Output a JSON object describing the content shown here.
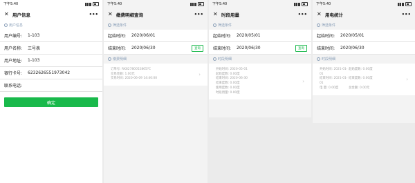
{
  "status": {
    "time": "下午5:40"
  },
  "screen1": {
    "title": "用户信息",
    "section": "用户信息",
    "rows": [
      {
        "label": "用户编号:",
        "value": "1-103"
      },
      {
        "label": "用户名称:",
        "value": "三号表"
      },
      {
        "label": "用户地址:",
        "value": "1-103"
      },
      {
        "label": "银行卡号:",
        "value": "6232626551973042"
      },
      {
        "label": "联系电话:",
        "value": ""
      }
    ],
    "confirm": "确定"
  },
  "screen2": {
    "title": "缴费明细查询",
    "filter_section": "筛选条件",
    "start_label": "起始时间:",
    "start_value": "2020/06/01",
    "end_label": "结束时间:",
    "end_value": "2020/06/30",
    "query": "查询",
    "detail_section": "缴费明细",
    "record": {
      "order": "订单号: RK82780052865?C",
      "amount": "交易金额: 1.00元",
      "time": "交易时间: 2020-06-09 14:40:00"
    }
  },
  "screen3": {
    "title": "时段用量",
    "filter_section": "筛选条件",
    "start_label": "起始时间:",
    "start_value": "2020/05/01",
    "end_label": "结束时间:",
    "end_value": "2020/06/30",
    "query": "查询",
    "detail_section": "时段明细",
    "record": [
      "开始时间: 2020-05-01",
      "起始度数: 0.00度",
      "结束时间: 2020-06-30",
      "结束度数: 0.00度",
      "使用度数: 0.00度",
      "时段用量: 0.00度"
    ]
  },
  "screen4": {
    "title": "用电统计",
    "filter_section": "筛选条件",
    "start_label": "起始时间:",
    "start_value": "2020/05/01",
    "end_label": "结束时间:",
    "end_value": "2020/06/30",
    "detail_section": "时段明细",
    "record": [
      "开始时间: 2021-01-01",
      "起始度数: 0.00度",
      "结束时间: 2021-01-01",
      "结束度数: 0.00度",
      "电    量: 0.00度",
      "总金额: 0.00元"
    ]
  }
}
